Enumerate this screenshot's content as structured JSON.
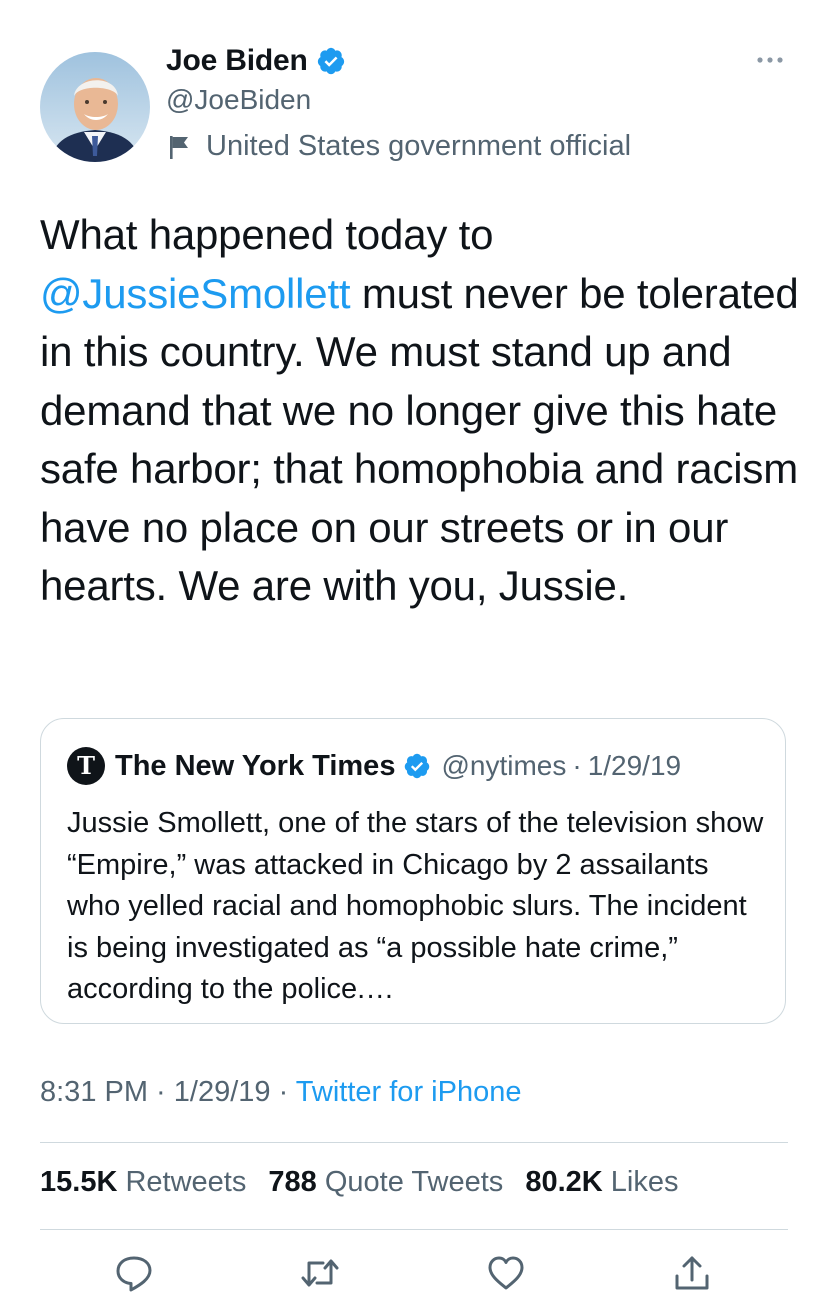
{
  "author": {
    "name": "Joe Biden",
    "handle": "@JoeBiden",
    "label": "United States government official"
  },
  "tweet": {
    "text_before": "What happened today to ",
    "mention": "@JussieSmollett",
    "text_after": " must never be tolerated in this country. We must stand up and demand that we no longer give this hate safe harbor; that homophobia and racism have no place on our streets or in our hearts. We are with you, Jussie."
  },
  "quote": {
    "name": "The New York Times",
    "handle": "@nytimes",
    "separator": "·",
    "date": "1/29/19",
    "text": "Jussie Smollett, one of the stars of the television show “Empire,” was attacked in Chicago by 2 assailants who yelled racial and homophobic slurs. The incident is being investigated as “a possible hate crime,” according to the police.…"
  },
  "meta": {
    "time": "8:31 PM",
    "sep1": " · ",
    "date": "1/29/19",
    "sep2": " · ",
    "source": "Twitter for iPhone"
  },
  "stats": {
    "retweets_count": "15.5K",
    "retweets_label": "Retweets",
    "quotes_count": "788",
    "quotes_label": "Quote Tweets",
    "likes_count": "80.2K",
    "likes_label": "Likes"
  },
  "icons": {
    "more": "more-icon",
    "verified": "verified-badge-icon",
    "flag": "flag-icon",
    "reply": "reply-icon",
    "retweet": "retweet-icon",
    "like": "like-icon",
    "share": "share-icon"
  },
  "colors": {
    "accent": "#1d9bf0",
    "text": "#0f1419",
    "secondary": "#536471",
    "border": "#cfd9de"
  }
}
